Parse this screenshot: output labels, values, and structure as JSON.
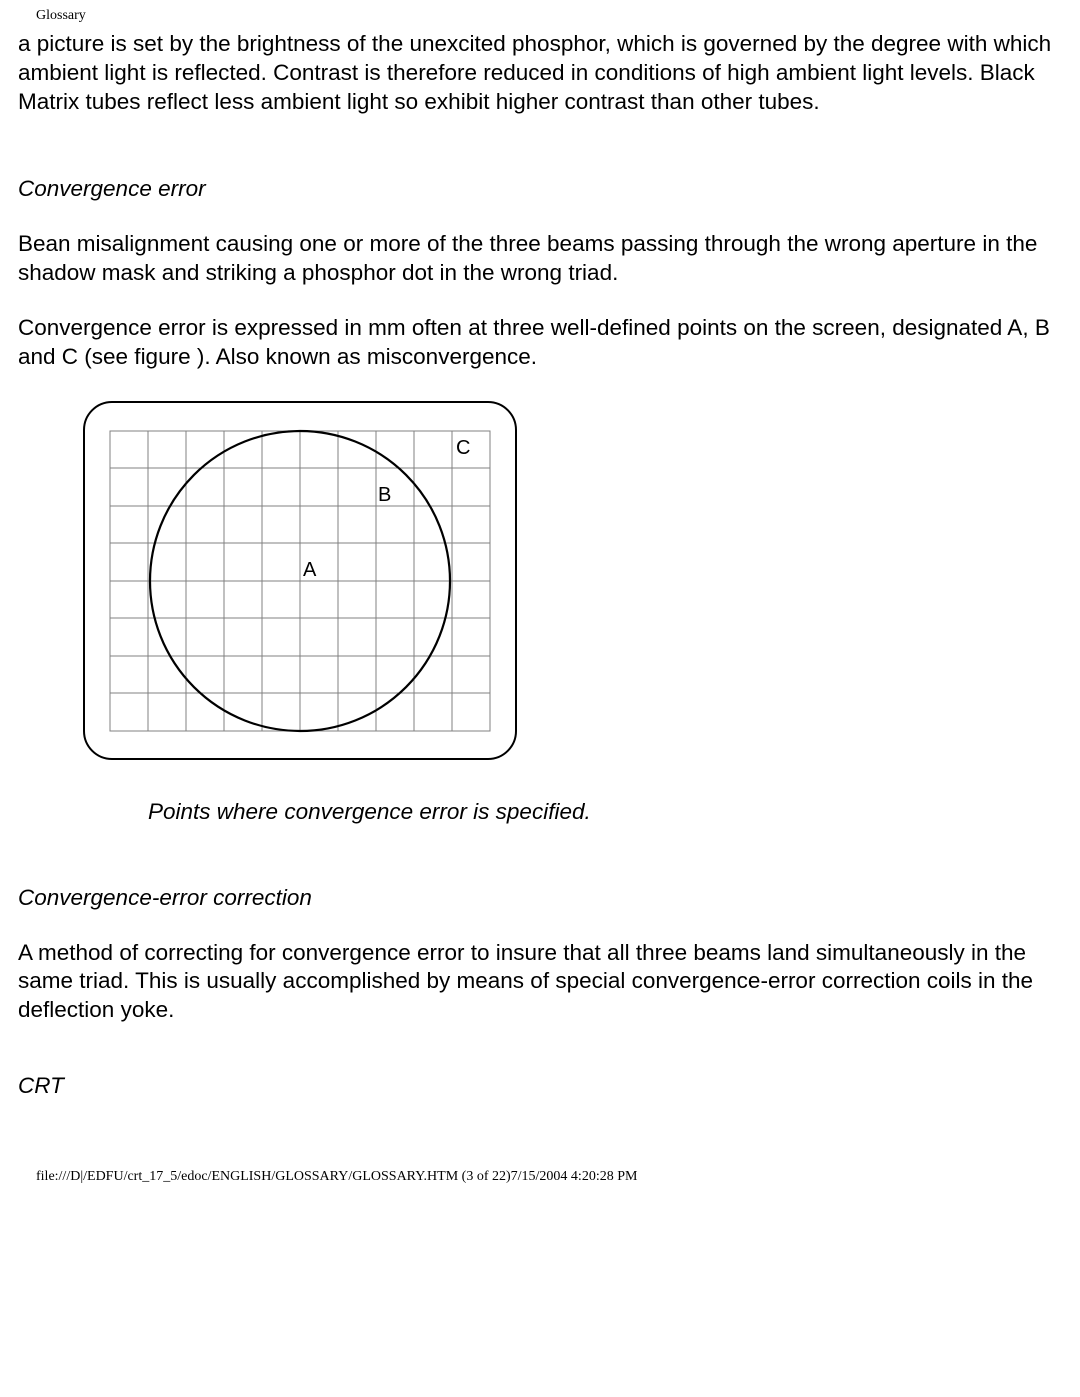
{
  "browser_title": "Glossary",
  "intro_paragraph": "a picture is set by the brightness of the unexcited phosphor, which is governed by the degree with which ambient light is reflected. Contrast is therefore reduced in conditions of high ambient light levels. Black Matrix tubes reflect less ambient light so exhibit higher contrast than other tubes.",
  "sections": {
    "convergence_error": {
      "heading": "Convergence error",
      "p1": "Bean misalignment causing one or more of the three beams passing through the wrong aperture in the shadow mask and striking a phosphor dot in the wrong triad.",
      "p2": "Convergence error is expressed in mm often at three well-defined points on the screen, designated A, B and C (see figure ). Also known as misconvergence.",
      "figure": {
        "labels": {
          "a": "A",
          "b": "B",
          "c": "C"
        },
        "caption": "Points where convergence error is specified."
      }
    },
    "convergence_error_correction": {
      "heading": "Convergence-error correction",
      "p1": "A method of correcting for convergence error to insure that all three beams land simultaneously in the same triad. This is usually accomplished by means of special convergence-error correction coils in the deflection yoke."
    },
    "crt": {
      "heading": "CRT"
    }
  },
  "footer": "file:///D|/EDFU/crt_17_5/edoc/ENGLISH/GLOSSARY/GLOSSARY.HTM (3 of 22)7/15/2004 4:20:28 PM"
}
